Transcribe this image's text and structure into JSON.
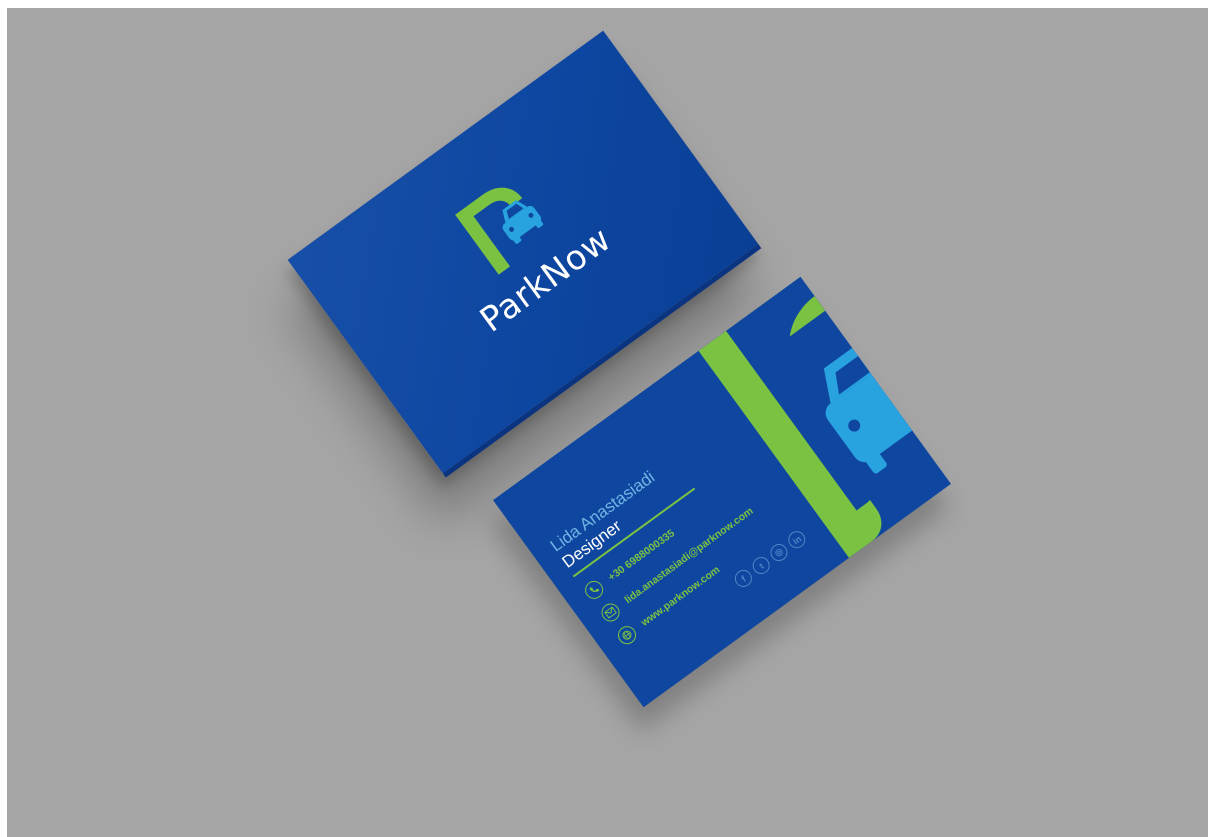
{
  "front": {
    "brand": "ParkNow"
  },
  "back": {
    "name": "Lida Anastasiadi",
    "role": "Designer",
    "phone": "+30 6988000335",
    "email": "lida.anastasiadi@parknow.com",
    "website": "www.parknow.com",
    "socials": [
      {
        "icon": "facebook-icon",
        "glyph": "f"
      },
      {
        "icon": "twitter-icon",
        "glyph": "t"
      },
      {
        "icon": "instagram-icon",
        "glyph": "◎"
      },
      {
        "icon": "linkedin-icon",
        "glyph": "in"
      }
    ]
  },
  "colors": {
    "background": "#a5a5a5",
    "card_blue": "#0f47a0",
    "brand_green": "#7cc242",
    "car_light_blue": "#29a3e0",
    "name_blue": "#6fb5e4"
  }
}
